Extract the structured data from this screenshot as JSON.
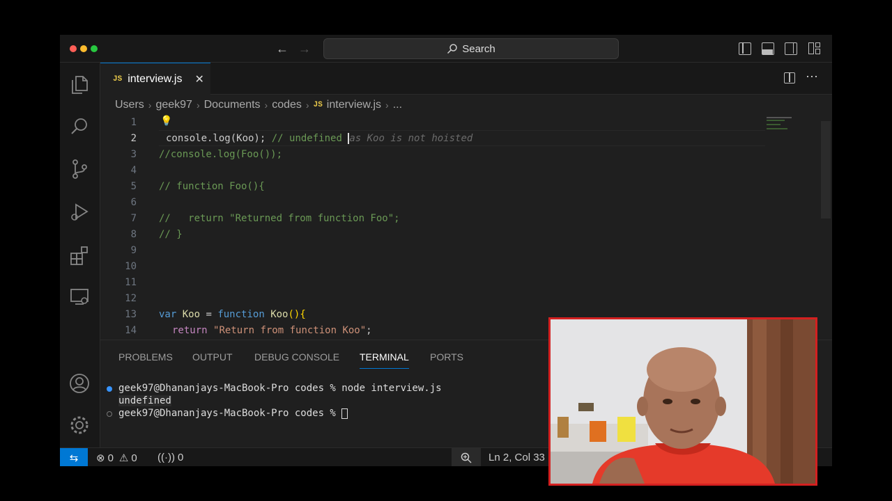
{
  "titlebar": {
    "search_label": "Search"
  },
  "tab": {
    "badge": "JS",
    "filename": "interview.js",
    "close": "✕"
  },
  "breadcrumb": {
    "items": [
      "Users",
      "geek97",
      "Documents",
      "codes"
    ],
    "file_badge": "JS",
    "file": "interview.js",
    "more": "..."
  },
  "editor": {
    "line_numbers": [
      "1",
      "2",
      "3",
      "4",
      "5",
      "6",
      "7",
      "8",
      "9",
      "10",
      "11",
      "12",
      "13",
      "14"
    ],
    "line2": {
      "code": "console.log(Koo);",
      "comment": " // undefined ",
      "ghost": "as Koo is not hoisted"
    },
    "line3": "//console.log(Foo());",
    "line5": "// function Foo(){",
    "line7": "//   return \"Returned from function Foo\";",
    "line8": "// }",
    "line13": {
      "kw": "var",
      "name": "Koo",
      "eq": " = ",
      "fnkw": "function",
      "fname": "Koo",
      "rest": "(){"
    },
    "line14": {
      "kw": "return",
      "str": "\"Return from function Koo\"",
      "end": ";"
    }
  },
  "panel": {
    "tabs": [
      "PROBLEMS",
      "OUTPUT",
      "DEBUG CONSOLE",
      "TERMINAL",
      "PORTS"
    ],
    "active_tab": "TERMINAL",
    "terminal": {
      "line1": "geek97@Dhananjays-MacBook-Pro codes % node interview.js",
      "line2": "undefined",
      "line3": "geek97@Dhananjays-MacBook-Pro codes % "
    }
  },
  "statusbar": {
    "errors": "0",
    "warnings": "0",
    "ports": "0",
    "position": "Ln 2, Col 33"
  },
  "colors": {
    "accent": "#0078d4",
    "webcam_border": "#d42020",
    "webcam_shirt": "#e53a2a"
  }
}
